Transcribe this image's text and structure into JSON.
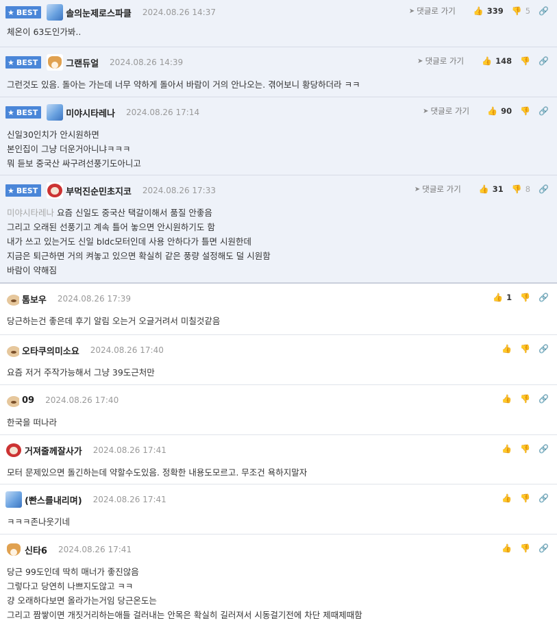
{
  "labels": {
    "best": "BEST",
    "reply_to": "댓글로 가기"
  },
  "icons": {
    "star": "star-icon",
    "reply_arrow": "navigation-arrow-icon",
    "thumbs_up": "thumbs-up-icon",
    "thumbs_down": "thumbs-down-icon",
    "link": "link-icon"
  },
  "colors": {
    "best_badge": "#4a86d8",
    "best_bg": "#eef2f9"
  },
  "best_comments": [
    {
      "nick": "솔의눈제로스파클",
      "date": "2024.08.26 14:37",
      "up": "339",
      "down": "5",
      "lines": [
        "체온이 63도인가봐.."
      ]
    },
    {
      "nick": "그랜듀얼",
      "date": "2024.08.26 14:39",
      "up": "148",
      "down": "",
      "lines": [
        "그런것도 있음. 돌아는 가는데 너무 약하게 돌아서 바람이 거의 안나오는. 겪어보니 황당하더라 ㅋㅋ"
      ]
    },
    {
      "nick": "미야시타레나",
      "date": "2024.08.26 17:14",
      "up": "90",
      "down": "",
      "lines": [
        "신일30인치가 안시원하면",
        "본인집이 그냥 더운거아니냐ㅋㅋㅋ",
        "뭐 듣보 중국산 싸구려선풍기도아니고"
      ]
    },
    {
      "nick": "부먹진순민초지코",
      "date": "2024.08.26 17:33",
      "up": "31",
      "down": "8",
      "mention": "미야시타레나",
      "lines": [
        "요즘 신일도 중국산 택갈이해서 품질 안좋음",
        "그리고 오래된 선풍기고 계속 틀어 놓으면 안시원하기도 함",
        "내가 쓰고 있는거도 신일 bldc모터인데 사용 안하다가 틀면 시원한데",
        "지금은 퇴근하면 거의 켜놓고 있으면 확실히 같은 풍량 설정해도 덜 시원함",
        "바람이 약해짐"
      ]
    }
  ],
  "comments": [
    {
      "nick": "톰보우",
      "date": "2024.08.26 17:39",
      "up": "1",
      "lines": [
        "당근하는건 좋은데 후기 알림 오는거 오글거려서 미칠것같음"
      ]
    },
    {
      "nick": "오타쿠의미소요",
      "date": "2024.08.26 17:40",
      "up": "",
      "lines": [
        "요즘 저거 주작가능해서 그냥 39도근처만"
      ]
    },
    {
      "nick": "09",
      "date": "2024.08.26 17:40",
      "up": "",
      "lines": [
        "한국을 떠나라"
      ]
    },
    {
      "nick": "거져줄께잘사가",
      "date": "2024.08.26 17:41",
      "up": "",
      "lines": [
        "모터 문제있으면 돌긴하는데 약할수도있음. 정확한 내용도모르고. 무조건 욕하지말자"
      ]
    },
    {
      "nick": "(빤스를내리며)",
      "date": "2024.08.26 17:41",
      "up": "",
      "lines": [
        "ㅋㅋㅋ존나웃기네"
      ]
    },
    {
      "nick": "신타6",
      "date": "2024.08.26 17:41",
      "up": "",
      "lines": [
        "당근 99도인데 딱히 매너가 좋진않음",
        "그렇다고 당연히 나쁘지도않고 ㅋㅋ",
        "걍 오래하다보면 올라가는거임 당근온도는",
        "그리고 짬쌓이면 개짓거리하는애들 걸러내는 안목은 확실히 길러져서 시동걸기전에 차단 제때제때함"
      ]
    }
  ]
}
